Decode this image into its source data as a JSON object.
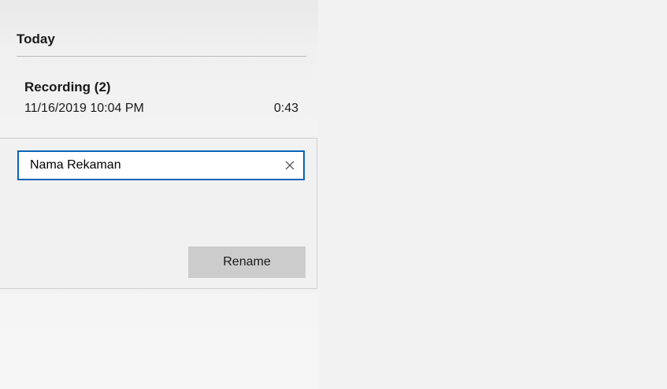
{
  "recordings_list": {
    "group_header": "Today",
    "items": [
      {
        "title": "Recording (2)",
        "date": "11/16/2019 10:04 PM",
        "duration": "0:43"
      }
    ]
  },
  "rename_flyout": {
    "input_value": "Nama Rekaman",
    "clear_icon": "close-icon",
    "rename_label": "Rename",
    "accent_color": "#0a63b8",
    "button_color": "#cccccc"
  }
}
